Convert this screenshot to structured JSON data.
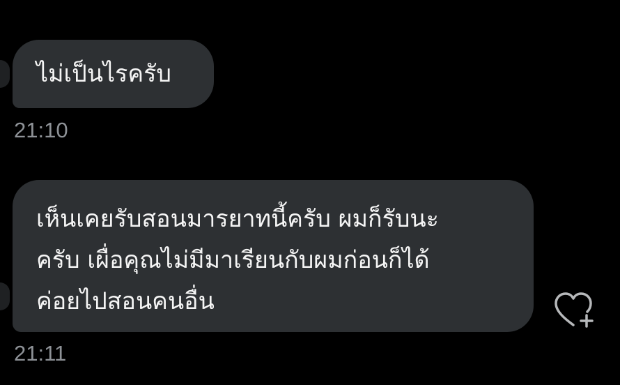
{
  "messages": [
    {
      "text": "ไม่เป็นไรครับ",
      "time": "21:10"
    },
    {
      "lines": [
        "เห็นเคยรับสอนมารยาทนี้ครับ ผมก็รับนะ",
        "ครับ เผื่อคุณไม่มีมาเรียนกับผมก่อนก็ได้",
        "ค่อยไปสอนคนอื่น"
      ],
      "time": "21:11"
    }
  ],
  "icons": {
    "reaction": "heart-plus-icon"
  },
  "colors": {
    "background": "#000000",
    "bubble": "#2d3033",
    "text": "#f5f5f5",
    "timestamp": "#8e9297"
  }
}
